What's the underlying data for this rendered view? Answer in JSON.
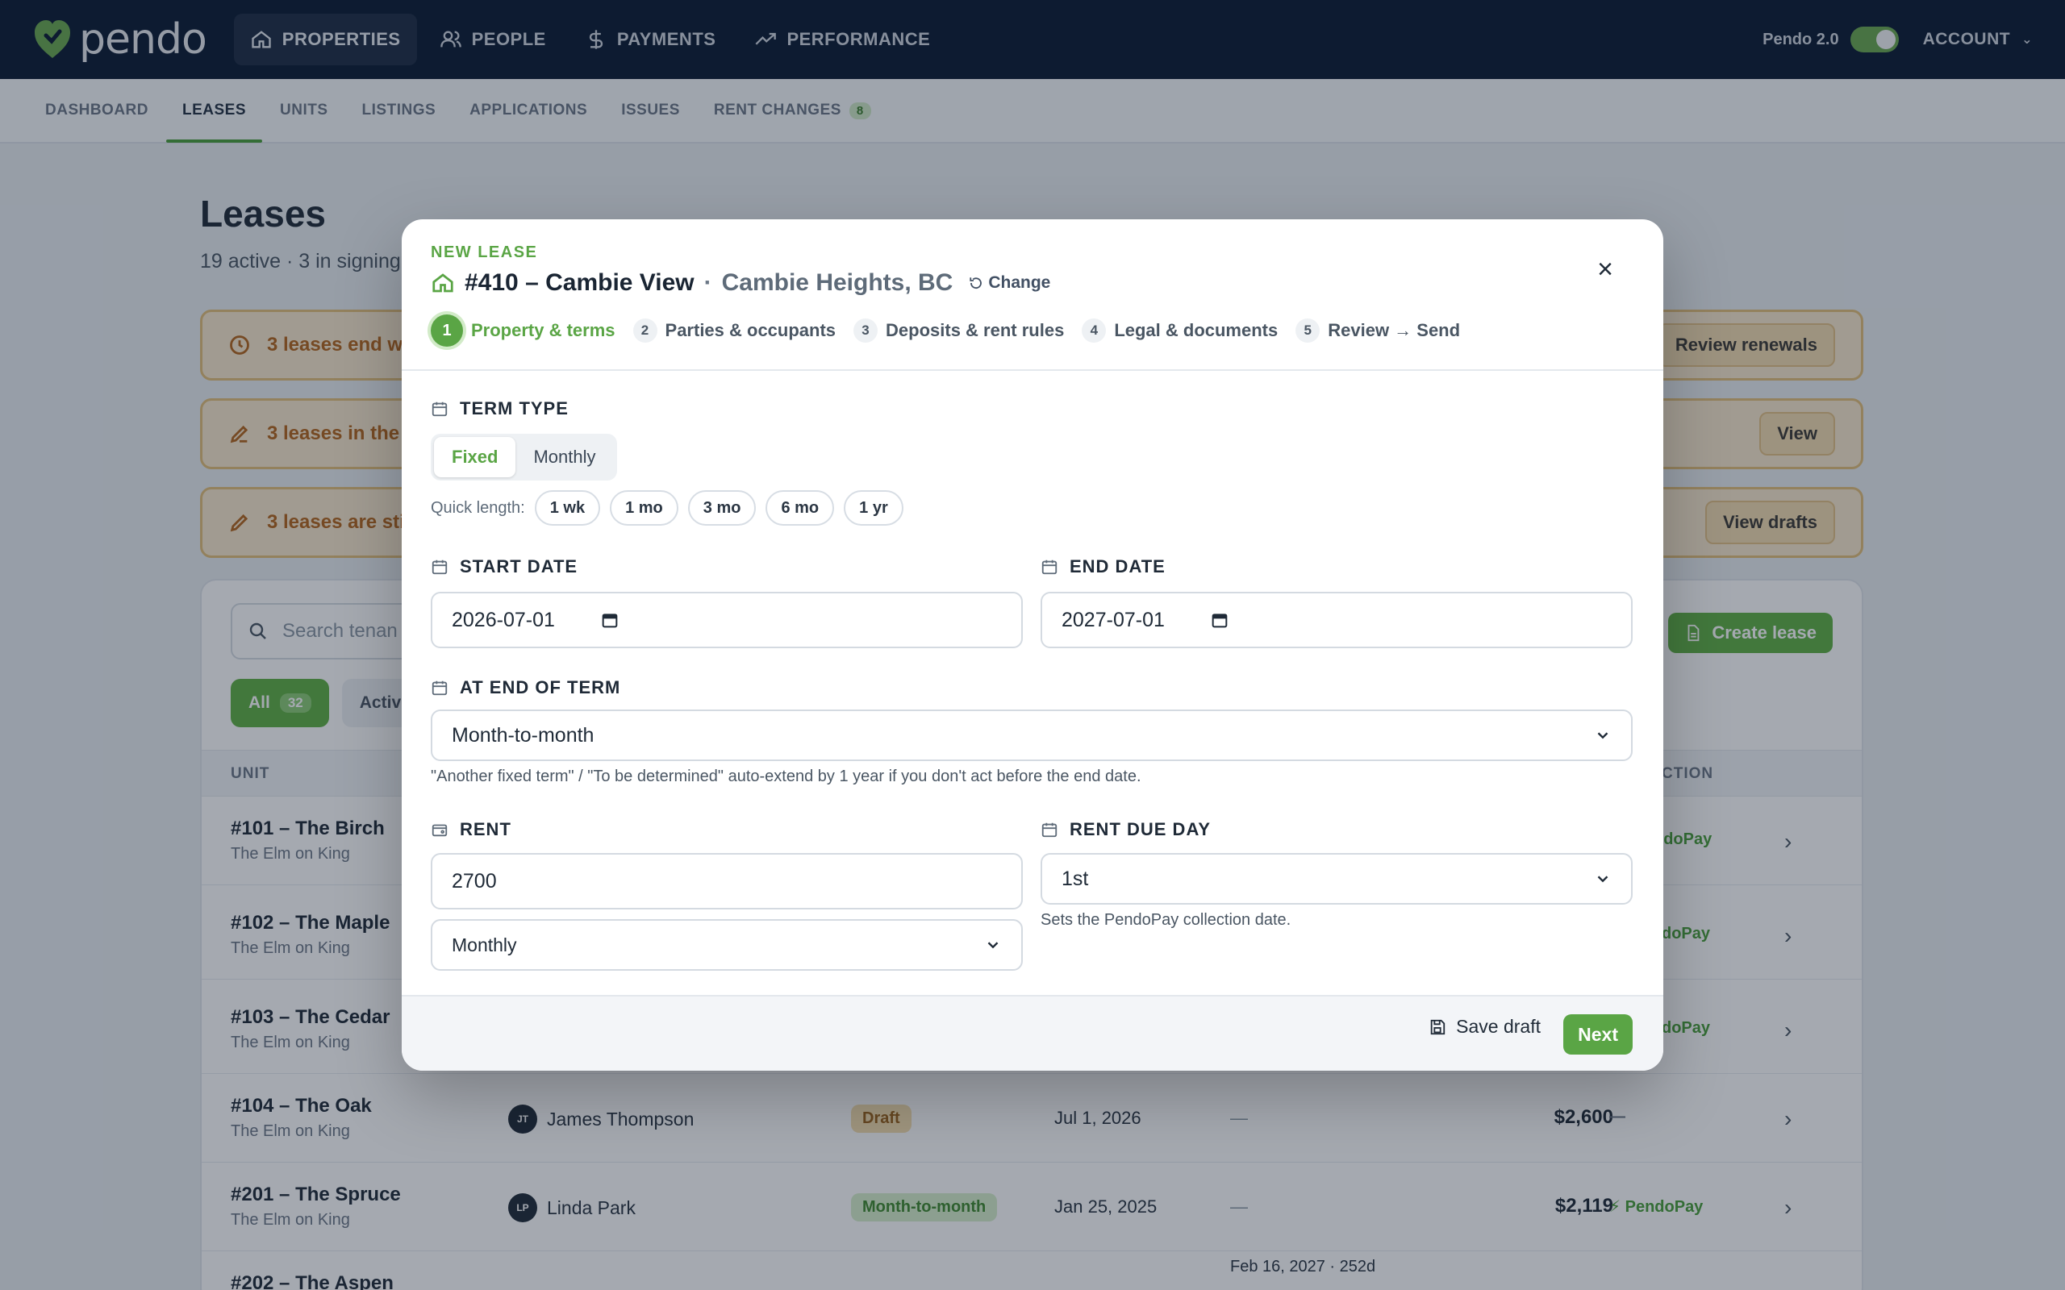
{
  "topnav": {
    "logo_text": "pendo",
    "items": [
      {
        "label": "PROPERTIES",
        "icon": "home-icon"
      },
      {
        "label": "PEOPLE",
        "icon": "people-icon"
      },
      {
        "label": "PAYMENTS",
        "icon": "dollar-icon"
      },
      {
        "label": "PERFORMANCE",
        "icon": "trending-up-icon"
      }
    ],
    "pendo_toggle_label": "Pendo 2.0",
    "account_label": "ACCOUNT"
  },
  "subnav": {
    "items": [
      {
        "label": "DASHBOARD"
      },
      {
        "label": "LEASES"
      },
      {
        "label": "UNITS"
      },
      {
        "label": "LISTINGS"
      },
      {
        "label": "APPLICATIONS"
      },
      {
        "label": "ISSUES"
      },
      {
        "label": "RENT CHANGES",
        "count": "8"
      }
    ]
  },
  "page": {
    "title": "Leases",
    "subtitle": "19 active · 3 in signing",
    "alerts": [
      {
        "text": "3 leases end wi",
        "button": "Review renewals"
      },
      {
        "text": "3 leases in the s",
        "button": "View"
      },
      {
        "text": "3 leases are sti",
        "button": "View drafts"
      }
    ],
    "search_placeholder": "Search tenan",
    "create_label": "Create lease",
    "filters": [
      {
        "label": "All",
        "count": "32"
      },
      {
        "label": "Activ"
      }
    ],
    "columns": {
      "unit": "UNIT",
      "action": "CTION"
    },
    "rows": [
      {
        "unit": "#101 – The Birch",
        "property": "The Elm on King",
        "pay": "ndoPay"
      },
      {
        "unit": "#102 – The Maple",
        "property": "The Elm on King",
        "pay": "doPay"
      },
      {
        "unit": "#103 – The Cedar",
        "property": "The Elm on King",
        "pay": "doPay"
      },
      {
        "unit": "#104 – The Oak",
        "property": "The Elm on King",
        "initials": "JT",
        "tenant": "James Thompson",
        "status": "Draft",
        "date": "Jul 1, 2026",
        "end": "—",
        "amount": "$2,600",
        "pay": "—"
      },
      {
        "unit": "#201 – The Spruce",
        "property": "The Elm on King",
        "initials": "LP",
        "tenant": "Linda Park",
        "status": "Month-to-month",
        "date": "Jan 25, 2025",
        "end": "—",
        "amount": "$2,119",
        "pay": "PendoPay"
      },
      {
        "unit": "#202 – The Aspen",
        "property": "",
        "end": "Feb 16, 2027 · 252d"
      }
    ]
  },
  "modal": {
    "eyebrow": "NEW LEASE",
    "unit": "#410 – Cambie View",
    "separator": "·",
    "property": "Cambie Heights, BC",
    "change_label": "Change",
    "steps": [
      {
        "num": "1",
        "label": "Property & terms"
      },
      {
        "num": "2",
        "label": "Parties & occupants"
      },
      {
        "num": "3",
        "label": "Deposits & rent rules"
      },
      {
        "num": "4",
        "label": "Legal & documents"
      },
      {
        "num": "5",
        "label": "Review → Send"
      }
    ],
    "term_type": {
      "label": "TERM TYPE",
      "options": [
        "Fixed",
        "Monthly"
      ],
      "selected": "Fixed"
    },
    "quick_length": {
      "label": "Quick length:",
      "options": [
        "1 wk",
        "1 mo",
        "3 mo",
        "6 mo",
        "1 yr"
      ]
    },
    "start_date": {
      "label": "START DATE",
      "value": "2026-07-01"
    },
    "end_date": {
      "label": "END DATE",
      "value": "2027-07-01"
    },
    "end_of_term": {
      "label": "AT END OF TERM",
      "value": "Month-to-month",
      "hint": "\"Another fixed term\" / \"To be determined\" auto-extend by 1 year if you don't act before the end date."
    },
    "rent": {
      "label": "RENT",
      "value": "2700",
      "frequency": "Monthly"
    },
    "rent_due_day": {
      "label": "RENT DUE DAY",
      "value": "1st",
      "hint": "Sets the PendoPay collection date."
    },
    "save_draft_label": "Save draft",
    "next_label": "Next"
  },
  "colors": {
    "brand_green": "#5aa545",
    "nav_bg": "#0b1b33",
    "alert_orange": "#b4661d"
  }
}
